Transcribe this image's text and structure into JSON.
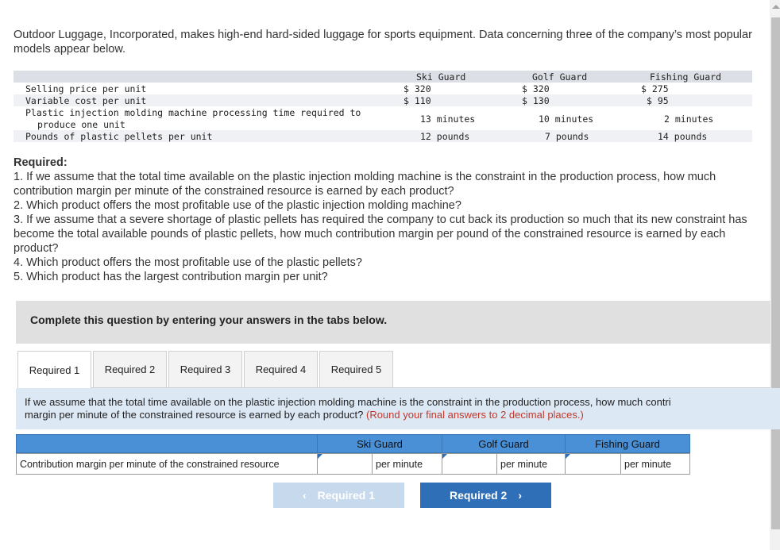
{
  "intro": "Outdoor Luggage, Incorporated, makes high-end hard-sided luggage for sports equipment. Data concerning three of the company’s most popular models appear below.",
  "table": {
    "headers": [
      "Ski Guard",
      "Golf Guard",
      "Fishing Guard"
    ],
    "rows": [
      {
        "label": "Selling price per unit",
        "values": [
          "$ 320",
          "$ 320",
          "$ 275"
        ]
      },
      {
        "label": "Variable cost per unit",
        "values": [
          "$ 110",
          "$ 130",
          "$ 95"
        ]
      },
      {
        "label": "Plastic injection molding machine processing time required to",
        "label2": "produce one unit",
        "values": [
          "13 minutes",
          "10 minutes",
          "2 minutes"
        ]
      },
      {
        "label": "Pounds of plastic pellets per unit",
        "values": [
          "12 pounds",
          "7 pounds",
          "14 pounds"
        ]
      }
    ]
  },
  "required": {
    "heading": "Required:",
    "items": [
      "1. If we assume that the total time available on the plastic injection molding machine is the constraint in the production process, how much contribution margin per minute of the constrained resource is earned by each product?",
      "2. Which product offers the most profitable use of the plastic injection molding machine?",
      "3. If we assume that a severe shortage of plastic pellets has required the company to cut back its production so much that its new constraint has become the total available pounds of plastic pellets, how much contribution margin per pound of the constrained resource is earned by each product?",
      "4. Which product offers the most profitable use of the plastic pellets?",
      "5. Which product has the largest contribution margin per unit?"
    ]
  },
  "complete_prompt": "Complete this question by entering your answers in the tabs below.",
  "tabs": [
    "Required 1",
    "Required 2",
    "Required 3",
    "Required 4",
    "Required 5"
  ],
  "active_tab": "Required 1",
  "question": {
    "line1": "If we assume that the total time available on the plastic injection molding machine is the constraint in the production process, how much contri",
    "line2": "margin per minute of the constrained resource is earned by each product?",
    "note": "(Round your final answers to 2 decimal places.)"
  },
  "answer_table": {
    "headers": [
      "Ski Guard",
      "Golf Guard",
      "Fishing Guard"
    ],
    "row_label": "Contribution margin per minute of the constrained resource",
    "unit": "per minute",
    "values": [
      "",
      "",
      ""
    ]
  },
  "nav": {
    "prev": "Required 1",
    "next": "Required 2"
  },
  "colors": {
    "header_blue": "#4a90d6",
    "button_blue": "#2f6fb8",
    "note_red": "#c0392b"
  }
}
